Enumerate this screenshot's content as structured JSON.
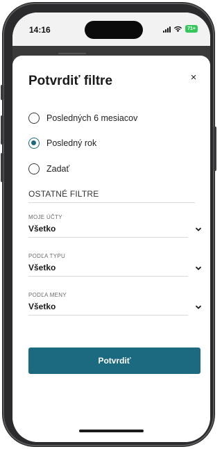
{
  "status_bar": {
    "time": "14:16",
    "battery": "71+"
  },
  "sheet": {
    "title": "Potvrdiť filtre",
    "close_icon": "×",
    "period_options": [
      {
        "label": "Posledných 6 mesiacov",
        "checked": false
      },
      {
        "label": "Posledný rok",
        "checked": true
      },
      {
        "label": "Zadať",
        "checked": false
      }
    ],
    "other_filters_title": "OSTATNÉ FILTRE",
    "fields": [
      {
        "caption": "MOJE ÚČTY",
        "value": "Všetko"
      },
      {
        "caption": "PODĽA TYPU",
        "value": "Všetko"
      },
      {
        "caption": "PODĽA MENY",
        "value": "Všetko"
      }
    ],
    "confirm_label": "Potvrdiť"
  },
  "colors": {
    "accent": "#1b6a80",
    "battery": "#34c759"
  }
}
